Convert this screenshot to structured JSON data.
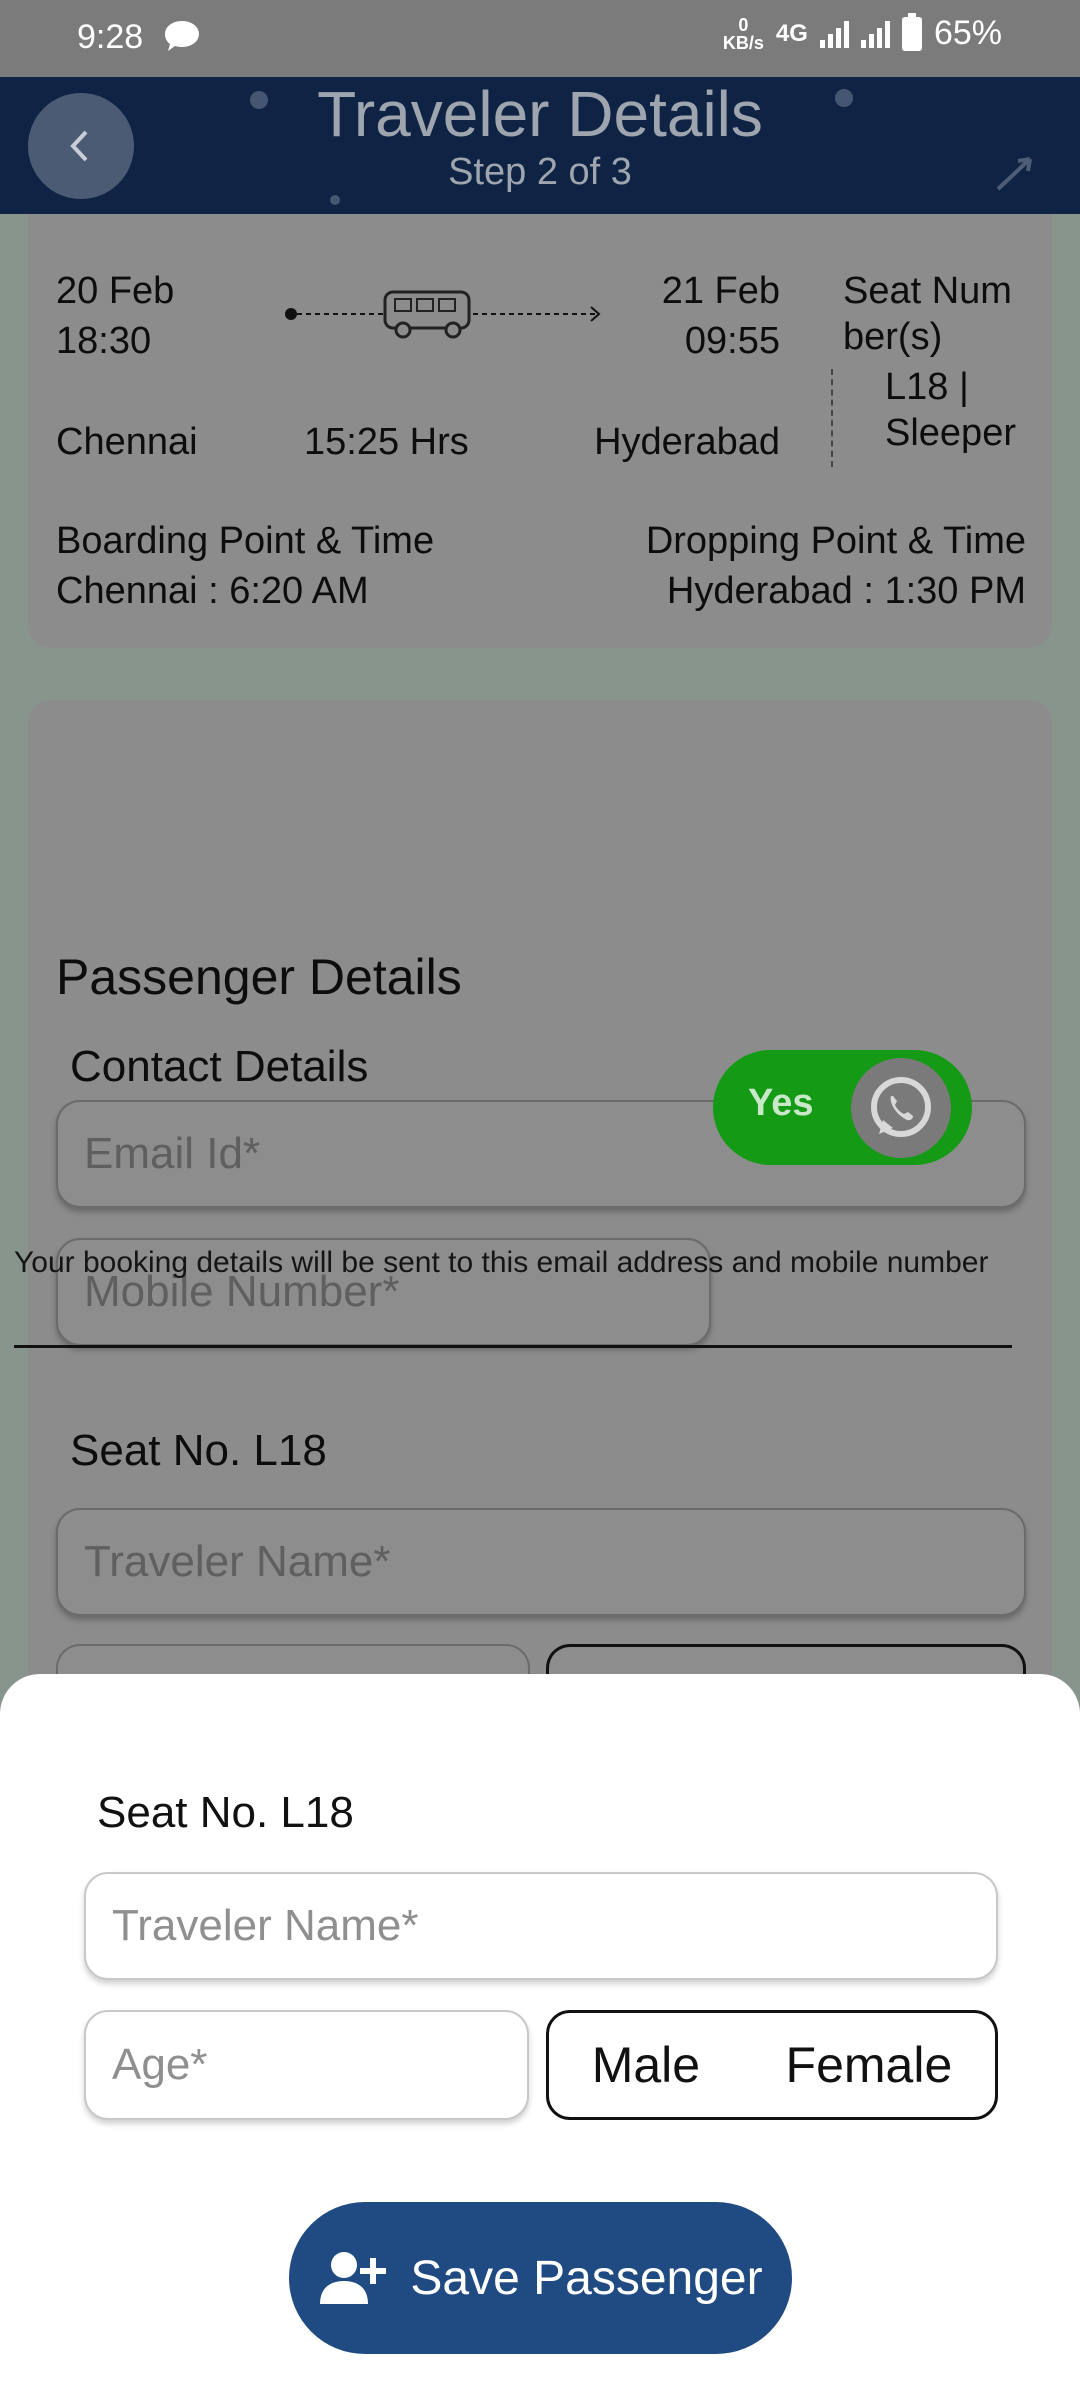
{
  "status_bar": {
    "time": "9:28",
    "net_speed_value": "0",
    "net_speed_unit": "KB/s",
    "network": "4G",
    "battery": "65%"
  },
  "header": {
    "title": "Traveler Details",
    "step": "Step 2 of 3",
    "back_icon": "chevron-left-icon",
    "color": "#0f2444"
  },
  "journey": {
    "departure_date": "20 Feb",
    "departure_time": "18:30",
    "arrival_date": "21 Feb",
    "arrival_time": "09:55",
    "origin": "Chennai",
    "duration": "15:25 Hrs",
    "destination": "Hyderabad",
    "seat_label_line1": "Seat Num",
    "seat_label_line2": "ber(s)",
    "seat_value_line1": "L18 |",
    "seat_value_line2": "Sleeper",
    "boarding_label": "Boarding Point & Time",
    "boarding_value": "Chennai : 6:20 AM",
    "dropping_label": "Dropping Point & Time",
    "dropping_value": "Hyderabad : 1:30 PM"
  },
  "passenger": {
    "title": "Passenger Details",
    "contact_title": "Contact Details",
    "email_placeholder": "Email Id*",
    "mobile_placeholder": "Mobile Number*",
    "whatsapp_label": "Yes",
    "note": "Your booking details will be sent to this email address and mobile number",
    "seat_title": "Seat No. L18",
    "traveler_placeholder": "Traveler Name*"
  },
  "sheet": {
    "seat_title": "Seat No. L18",
    "traveler_placeholder": "Traveler Name*",
    "age_placeholder": "Age*",
    "gender_male": "Male",
    "gender_female": "Female",
    "save_label": "Save Passenger",
    "save_color": "#1f4a82"
  }
}
